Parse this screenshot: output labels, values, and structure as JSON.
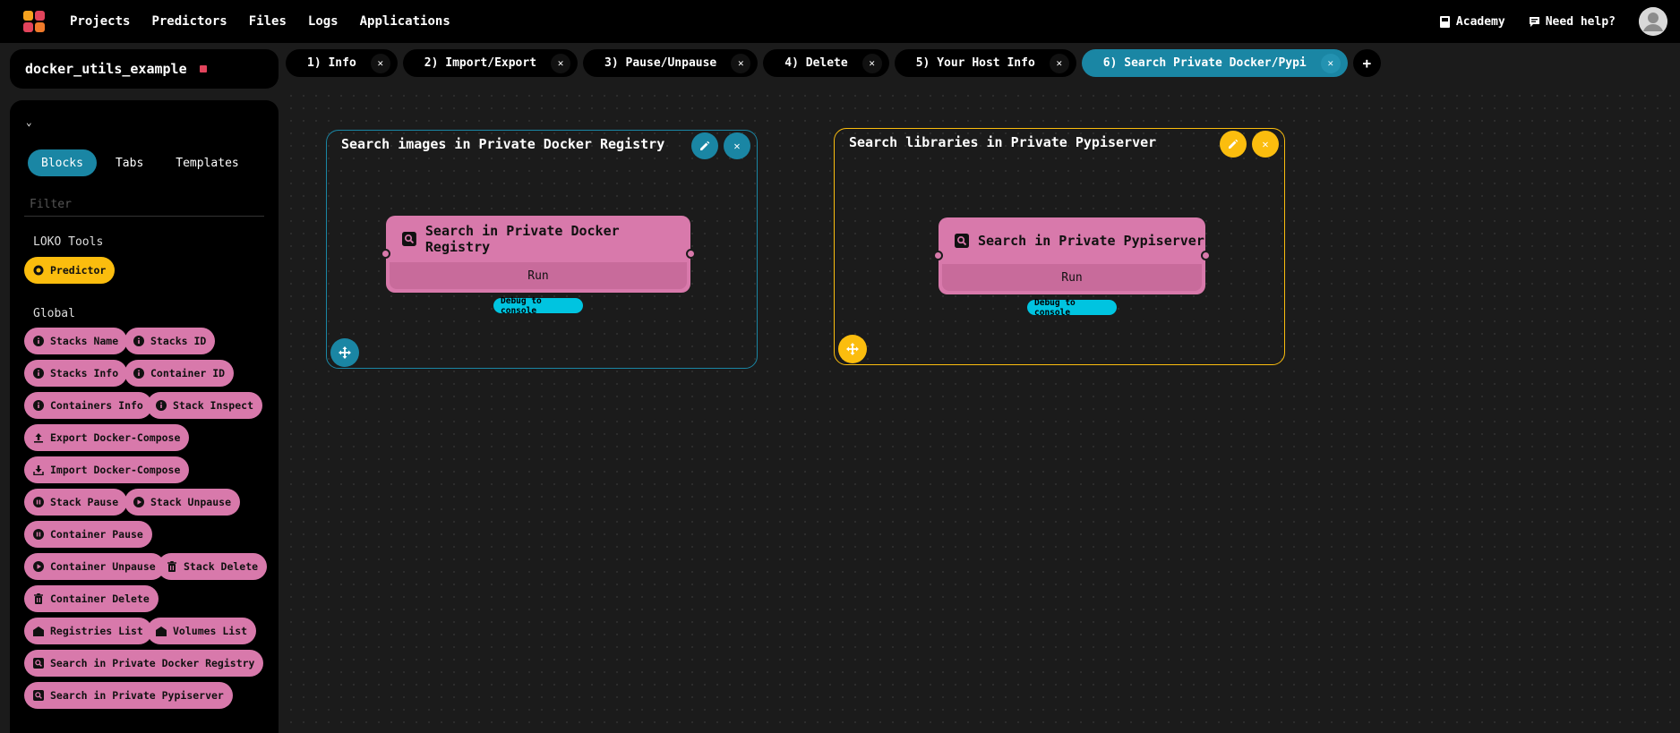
{
  "nav": {
    "items": [
      "Projects",
      "Predictors",
      "Files",
      "Logs",
      "Applications"
    ],
    "academy": "Academy",
    "help": "Need help?"
  },
  "project": {
    "name": "docker_utils_example"
  },
  "tabs": [
    {
      "label": "1) Info",
      "active": false
    },
    {
      "label": "2) Import/Export",
      "active": false
    },
    {
      "label": "3) Pause/Unpause",
      "active": false
    },
    {
      "label": "4) Delete",
      "active": false
    },
    {
      "label": "5) Your Host Info",
      "active": false
    },
    {
      "label": "6) Search Private Docker/Pypi",
      "active": true
    }
  ],
  "tab_add": "+",
  "sidebar": {
    "segments": [
      "Blocks",
      "Tabs",
      "Templates"
    ],
    "filter_placeholder": "Filter",
    "groups": [
      {
        "title": "LOKO Tools",
        "items": [
          "Predictor"
        ]
      },
      {
        "title": "Global",
        "items": [
          "Stacks Name",
          "Stacks ID",
          "Stacks Info",
          "Container ID",
          "Containers Info",
          "Stack Inspect",
          "Export Docker-Compose",
          "Import Docker-Compose",
          "Stack Pause",
          "Stack Unpause",
          "Container Pause",
          "Container Unpause",
          "Stack Delete",
          "Container Delete",
          "Registries List",
          "Volumes List",
          "Search in Private Docker Registry",
          "Search in Private Pypiserver"
        ]
      }
    ]
  },
  "canvas": {
    "groups": [
      {
        "title": "Search images in Private Docker Registry",
        "color": "#1a86a4",
        "node": {
          "title": "Search in Private Docker Registry",
          "run": "Run",
          "debug": "Debug to console"
        }
      },
      {
        "title": "Search libraries in Private Pypiserver",
        "color": "#fbbd0e",
        "node": {
          "title": "Search in Private Pypiserver",
          "run": "Run",
          "debug": "Debug to console"
        }
      }
    ]
  },
  "colors": {
    "accent": "#1a86a4",
    "block": "#d879ab",
    "tool": "#fbbd0e",
    "debug": "#00c4e0"
  }
}
